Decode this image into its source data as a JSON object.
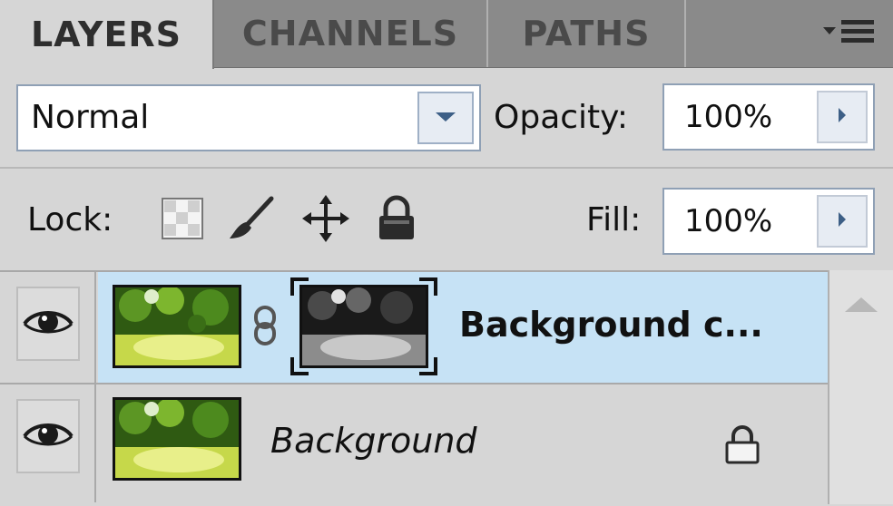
{
  "tabs": [
    {
      "label": "LAYERS",
      "active": true
    },
    {
      "label": "CHANNELS",
      "active": false
    },
    {
      "label": "PATHS",
      "active": false
    }
  ],
  "panel_menu_icon": "panel-menu-icon",
  "blend_mode": {
    "value": "Normal"
  },
  "opacity": {
    "label": "Opacity:",
    "value": "100%"
  },
  "lock": {
    "label": "Lock:",
    "icons": [
      "lock-transparent-pixels-icon",
      "lock-image-pixels-icon",
      "lock-position-icon",
      "lock-all-icon"
    ]
  },
  "fill": {
    "label": "Fill:",
    "value": "100%"
  },
  "layers": [
    {
      "name": "Background c...",
      "selected": true,
      "visible": true,
      "has_mask": true,
      "locked": false
    },
    {
      "name": "Background",
      "selected": false,
      "visible": true,
      "has_mask": false,
      "locked": true
    }
  ],
  "colors": {
    "selected_row": "#c6e2f5",
    "panel": "#d6d6d6",
    "tab_bar": "#8a8a8a"
  }
}
